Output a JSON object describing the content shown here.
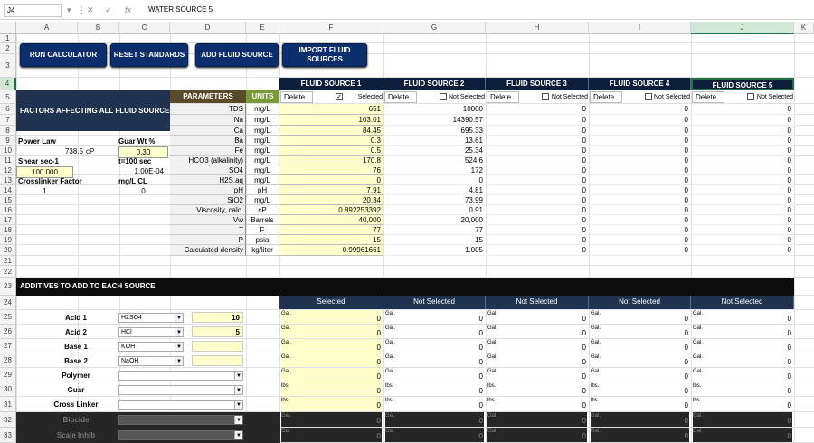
{
  "formula_bar": {
    "name_box": "J4",
    "formula": "WATER SOURCE 5",
    "icons": [
      "cancel-icon",
      "enter-icon",
      "function-icon"
    ]
  },
  "columns": [
    "A",
    "B",
    "C",
    "D",
    "E",
    "F",
    "G",
    "H",
    "I",
    "J",
    "K"
  ],
  "rows": [
    "1",
    "2",
    "3",
    "4",
    "5",
    "6",
    "7",
    "8",
    "9",
    "10",
    "11",
    "12",
    "13",
    "14",
    "15",
    "16",
    "17",
    "18",
    "19",
    "20",
    "21",
    "22",
    "23",
    "24",
    "25",
    "26",
    "27",
    "28",
    "29",
    "30",
    "31",
    "32",
    "33"
  ],
  "buttons": {
    "run": "RUN CALCULATOR",
    "reset": "RESET STANDARDS",
    "add": "ADD FLUID SOURCE",
    "import_l1": "IMPORT FLUID",
    "import_l2": "SOURCES"
  },
  "fluid_sources": [
    {
      "name": "FLUID SOURCE 1",
      "delete": "Delete",
      "checked": "✓",
      "status": "Selected"
    },
    {
      "name": "FLUID SOURCE 2",
      "delete": "Delete",
      "checked": "",
      "status": "Not Selected"
    },
    {
      "name": "FLUID SOURCE 3",
      "delete": "Delete",
      "checked": "",
      "status": "Not Selected"
    },
    {
      "name": "FLUID SOURCE 4",
      "delete": "Delete",
      "checked": "",
      "status": "Not Selected"
    },
    {
      "name": "FLUID SOURCE 5",
      "delete": "Delete",
      "checked": "",
      "status": "Not Selected"
    }
  ],
  "factors": {
    "title": "FACTORS AFFECTING ALL FLUID SOURCES",
    "power_law": "Power Law",
    "guar_wt": "Guar Wt %",
    "cp_val": "738.5",
    "cp_unit": "cP",
    "guar_val": "0.30",
    "shear": "Shear sec-1",
    "t_label": "t=100 sec",
    "shear_val": "100.000",
    "t_val": "1.00E-04",
    "crosslinker": "Crosslinker Factor",
    "mgl_cl": "mg/L CL",
    "cl_val": "1",
    "cl_val2": "0"
  },
  "params_header": "PARAMETERS",
  "units_header": "UNITS",
  "params": [
    {
      "p": "TDS",
      "u": "mg/L",
      "v": [
        "651",
        "10000",
        "0",
        "0",
        "0"
      ]
    },
    {
      "p": "Na",
      "u": "mg/L",
      "v": [
        "103.01",
        "14390.57",
        "0",
        "0",
        "0"
      ]
    },
    {
      "p": "Ca",
      "u": "mg/L",
      "v": [
        "84.45",
        "695.33",
        "0",
        "0",
        "0"
      ]
    },
    {
      "p": "Ba",
      "u": "mg/L",
      "v": [
        "0.3",
        "13.61",
        "0",
        "0",
        "0"
      ]
    },
    {
      "p": "Fe",
      "u": "mg/L",
      "v": [
        "0.5",
        "25.34",
        "0",
        "0",
        "0"
      ]
    },
    {
      "p": "HCO3 (alkalinity)",
      "u": "mg/L",
      "v": [
        "170.8",
        "524.6",
        "0",
        "0",
        "0"
      ]
    },
    {
      "p": "SO4",
      "u": "mg/L",
      "v": [
        "76",
        "172",
        "0",
        "0",
        "0"
      ]
    },
    {
      "p": "H2S.aq",
      "u": "mg/L",
      "v": [
        "0",
        "0",
        "0",
        "0",
        "0"
      ]
    },
    {
      "p": "pH",
      "u": "pH",
      "v": [
        "7.91",
        "4.81",
        "0",
        "0",
        "0"
      ]
    },
    {
      "p": "SiO2",
      "u": "mg/L",
      "v": [
        "20.34",
        "73.99",
        "0",
        "0",
        "0"
      ]
    },
    {
      "p": "Viscosity, calc.",
      "u": "cP",
      "v": [
        "0.892253392",
        "0.91",
        "0",
        "0",
        "0"
      ]
    },
    {
      "p": "Vw",
      "u": "Barrels",
      "v": [
        "40,000",
        "20,000",
        "0",
        "0",
        "0"
      ]
    },
    {
      "p": "T",
      "u": "F",
      "v": [
        "77",
        "77",
        "0",
        "0",
        "0"
      ]
    },
    {
      "p": "P",
      "u": "psia",
      "v": [
        "15",
        "15",
        "0",
        "0",
        "0"
      ]
    },
    {
      "p": "Calculated density",
      "u": "kg/liter",
      "v": [
        "0.99961661",
        "1.005",
        "0",
        "0",
        "0"
      ]
    }
  ],
  "additives": {
    "title": "ADDITIVES TO ADD TO EACH SOURCE",
    "status_headers": [
      "Selected",
      "Not Selected",
      "Not Selected",
      "Not Selected",
      "Not Selected"
    ],
    "rows": [
      {
        "label": "Acid 1",
        "dd": "H2SO4",
        "val": "10",
        "unit": "Gal."
      },
      {
        "label": "Acid 2",
        "dd": "HCl",
        "val": "5",
        "unit": "Gal."
      },
      {
        "label": "Base 1",
        "dd": "KOH",
        "val": "",
        "unit": "Gal."
      },
      {
        "label": "Base 2",
        "dd": "NaOH",
        "val": "",
        "unit": "Gal."
      },
      {
        "label": "Polymer",
        "dd": "",
        "val": "",
        "unit": "Gal."
      },
      {
        "label": "Guar",
        "dd": "",
        "val": "",
        "unit": "lbs."
      },
      {
        "label": "Cross Linker",
        "dd": "",
        "val": "",
        "unit": "lbs."
      },
      {
        "label": "Biocide",
        "dd": "",
        "val": "",
        "unit": "Gal."
      },
      {
        "label": "Scale Inhib",
        "dd": "",
        "val": "",
        "unit": "Gal."
      }
    ],
    "zero": "0"
  }
}
